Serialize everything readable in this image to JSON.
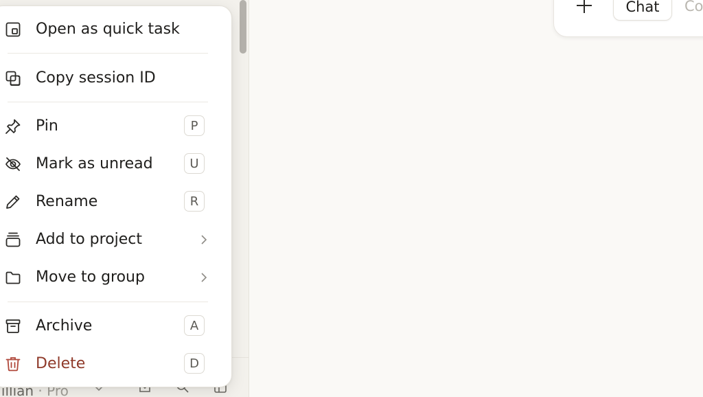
{
  "menu": {
    "items": [
      {
        "label": "Open as quick task",
        "icon": "quick-task-icon"
      },
      {
        "label": "Copy session ID",
        "icon": "copy-icon"
      },
      {
        "label": "Pin",
        "icon": "pin-icon",
        "shortcut": "P"
      },
      {
        "label": "Mark as unread",
        "icon": "eye-off-icon",
        "shortcut": "U"
      },
      {
        "label": "Rename",
        "icon": "pencil-icon",
        "shortcut": "R"
      },
      {
        "label": "Add to project",
        "icon": "project-stack-icon"
      },
      {
        "label": "Move to group",
        "icon": "folder-icon"
      },
      {
        "label": "Archive",
        "icon": "archive-icon",
        "shortcut": "A"
      },
      {
        "label": "Delete",
        "icon": "trash-icon",
        "shortcut": "D"
      }
    ]
  },
  "toolbar": {
    "tabs": [
      {
        "label": "Chat"
      },
      {
        "label": "Co"
      }
    ]
  },
  "sidebar": {
    "user_name": "Jillian",
    "plan": "Pro"
  },
  "colors": {
    "danger": "#8f3a2a",
    "background": "#faf9f6",
    "menu_bg": "#ffffff"
  }
}
